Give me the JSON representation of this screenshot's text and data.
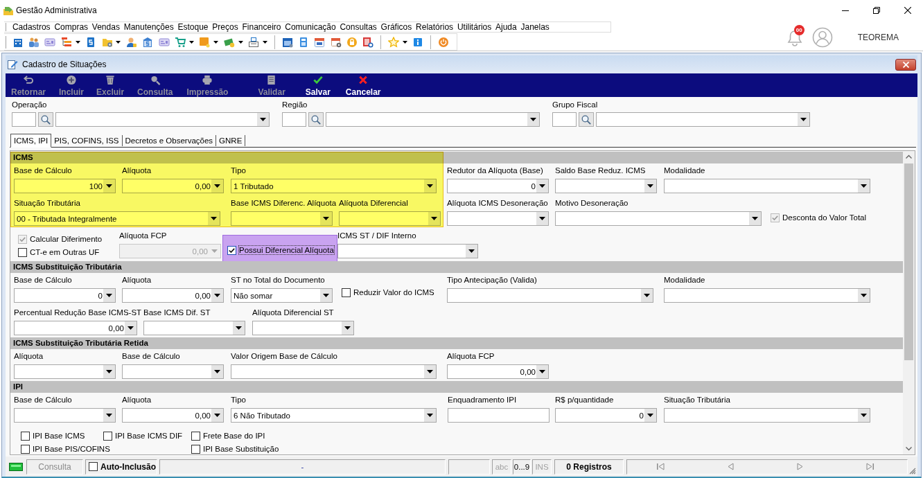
{
  "app": {
    "title": "Gestão Administrativa",
    "notifications": "00",
    "user": "TEOREMA"
  },
  "menu": [
    "Cadastros",
    "Compras",
    "Vendas",
    "Manutenções",
    "Estoque",
    "Preços",
    "Financeiro",
    "Comunicação",
    "Consultas",
    "Gráficos",
    "Relatórios",
    "Utilitários",
    "Ajuda",
    "Janelas"
  ],
  "window": {
    "title": "Cadastro de Situações"
  },
  "toolbar": [
    {
      "label": "Retornar",
      "disabled": true
    },
    {
      "label": "Incluir",
      "disabled": true
    },
    {
      "label": "Excluir",
      "disabled": true
    },
    {
      "label": "Consulta",
      "disabled": true
    },
    {
      "label": "Impressão",
      "disabled": true
    },
    {
      "label": "Validar",
      "disabled": true
    },
    {
      "label": "Salvar",
      "disabled": false
    },
    {
      "label": "Cancelar",
      "disabled": false
    }
  ],
  "lookups": [
    {
      "label": "Operação"
    },
    {
      "label": "Região"
    },
    {
      "label": "Grupo Fiscal"
    }
  ],
  "tabs": [
    {
      "label": "ICMS, IPI",
      "selected": true
    },
    {
      "label": "PIS, COFINS, ISS",
      "selected": false
    },
    {
      "label": "Decretos e Observações",
      "selected": false
    },
    {
      "label": "GNRE",
      "selected": false
    }
  ],
  "highlights": [
    {
      "color": "#ffff66"
    },
    {
      "color": "#cfa8f7"
    }
  ],
  "sections": [
    {
      "title": "ICMS",
      "rows": [
        [
          {
            "kind": "number",
            "label": "Base de Cálculo",
            "value": "100",
            "disabled": false
          },
          {
            "kind": "number",
            "label": "Alíquota",
            "value": "0,00",
            "disabled": false
          },
          {
            "kind": "combo",
            "label": "Tipo",
            "value": "1 Tributado",
            "disabled": false
          },
          "",
          {
            "kind": "number",
            "label": "Redutor da Alíquota (Base)",
            "value": "0",
            "disabled": false
          },
          {
            "kind": "combo",
            "label": "Saldo Base Reduz. ICMS",
            "disabled": false
          },
          {
            "kind": "combo",
            "label": "Modalidade",
            "disabled": false
          }
        ],
        [
          {
            "kind": "combo",
            "label": "Situação Tributária",
            "value": "00 - Tributada Integralmente",
            "disabled": false
          },
          "",
          {
            "kind": "combo",
            "label": "Base ICMS Diferenc. Alíquota",
            "disabled": false
          },
          {
            "kind": "combo",
            "label": "Alíquota Diferencial",
            "disabled": false
          },
          {
            "kind": "combo",
            "label": "Alíquota ICMS Desoneração",
            "disabled": false
          },
          {
            "kind": "combo",
            "label": "Motivo Desoneração",
            "disabled": false
          },
          {
            "kind": "checkbox",
            "label": "Desconta do Valor Total",
            "checked": true,
            "disabled": true
          }
        ],
        [
          {
            "kind": "checkbox",
            "label": "Calcular Diferimento",
            "checked": true,
            "disabled": true
          },
          {
            "kind": "number",
            "label": "Alíquota FCP",
            "value": "0,00",
            "disabled": true
          },
          {
            "kind": "checkbox",
            "label": "Possui Diferencial Alíquota",
            "checked": true,
            "disabled": false
          },
          {
            "kind": "combo",
            "label": "ICMS ST / DIF Interno",
            "disabled": false
          }
        ],
        [
          {
            "kind": "checkbox",
            "label": "CT-e em Outras UF",
            "checked": false,
            "disabled": false
          }
        ]
      ]
    },
    {
      "title": "ICMS Substituição Tributária",
      "rows": [
        [
          {
            "kind": "number",
            "label": "Base de Cálculo",
            "value": "0",
            "disabled": false
          },
          {
            "kind": "number",
            "label": "Alíquota",
            "value": "0,00",
            "disabled": false
          },
          {
            "kind": "combo",
            "label": "ST no Total do Documento",
            "value": "Não somar",
            "disabled": false
          },
          {
            "kind": "checkbox",
            "label": "Reduzir Valor do ICMS",
            "checked": false,
            "disabled": false
          },
          {
            "kind": "combo",
            "label": "Tipo Antecipação (Valida)",
            "disabled": false
          },
          {
            "kind": "combo",
            "label": "Modalidade",
            "disabled": false
          }
        ],
        [
          {
            "kind": "number",
            "label": "Percentual Redução Base ICMS-ST",
            "value": "0,00",
            "disabled": false
          },
          {
            "kind": "combo",
            "label": "Base ICMS Dif. ST",
            "disabled": false
          },
          {
            "kind": "combo",
            "label": "Alíquota Diferencial ST",
            "disabled": false
          }
        ]
      ]
    },
    {
      "title": "ICMS Substituição Tributária Retida",
      "rows": [
        [
          {
            "kind": "combo",
            "label": "Alíquota",
            "disabled": false
          },
          {
            "kind": "combo",
            "label": "Base de Cálculo",
            "disabled": false
          },
          {
            "kind": "combo",
            "label": "Valor Origem Base de Cálculo",
            "disabled": false
          },
          {
            "kind": "number",
            "label": "Alíquota FCP",
            "value": "0,00",
            "disabled": false
          }
        ]
      ]
    },
    {
      "title": "IPI",
      "rows": [
        [
          {
            "kind": "combo",
            "label": "Base de Cálculo",
            "disabled": false
          },
          {
            "kind": "number",
            "label": "Alíquota",
            "value": "0,00",
            "disabled": false
          },
          {
            "kind": "combo",
            "label": "Tipo",
            "value": "6 Não Tributado",
            "disabled": false
          },
          {
            "kind": "input",
            "label": "Enquadramento IPI",
            "disabled": false
          },
          {
            "kind": "number",
            "label": "R$ p/quantidade",
            "value": "0",
            "disabled": false
          },
          {
            "kind": "combo",
            "label": "Situação Tributária",
            "disabled": false
          }
        ],
        [
          {
            "kind": "checkbox",
            "label": "IPI Base ICMS",
            "checked": false,
            "disabled": false
          },
          {
            "kind": "checkbox",
            "label": "IPI Base ICMS DIF",
            "checked": false,
            "disabled": false
          },
          {
            "kind": "checkbox",
            "label": "Frete Base do IPI",
            "checked": false,
            "disabled": false
          }
        ],
        [
          {
            "kind": "checkbox",
            "label": "IPI Base PIS/COFINS",
            "checked": false,
            "disabled": false
          },
          "",
          {
            "kind": "checkbox",
            "label": "IPI Base Substituição",
            "checked": false,
            "disabled": false
          }
        ]
      ]
    }
  ],
  "status_bar": {
    "mode": "Consulta",
    "auto_inclusion": {
      "label": "Auto-Inclusão",
      "checked": false
    },
    "message": "-",
    "indicators": [
      {
        "label": "abc",
        "active": false
      },
      {
        "label": "0...9",
        "active": true
      },
      {
        "label": "INS",
        "active": false
      }
    ],
    "records": "0 Registros"
  }
}
